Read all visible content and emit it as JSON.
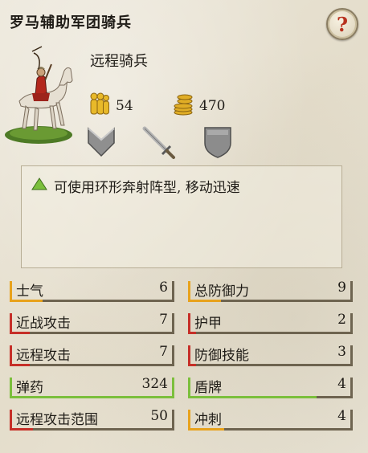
{
  "header": {
    "title": "罗马辅助军团骑兵",
    "help_label": "?"
  },
  "unit": {
    "type_label": "远程骑兵",
    "men": "54",
    "cost": "470",
    "icons": [
      "men-icon",
      "coins-icon",
      "armor-chevron-icon",
      "sword-icon",
      "shield-icon"
    ]
  },
  "abilities": [
    {
      "text": "可使用环形奔射阵型, 移动迅速",
      "icon": "green-triangle-icon"
    }
  ],
  "stats": {
    "left": [
      {
        "label": "士气",
        "value": "6",
        "level": 0.2,
        "color": "#e8a21c"
      },
      {
        "label": "近战攻击",
        "value": "7",
        "level": 0.12,
        "color": "#c62f28"
      },
      {
        "label": "远程攻击",
        "value": "7",
        "level": 0.12,
        "color": "#c62f28"
      },
      {
        "label": "弹药",
        "value": "324",
        "level": 1.0,
        "color": "#7bbf3c"
      },
      {
        "label": "远程攻击范围",
        "value": "50",
        "level": 0.14,
        "color": "#c62f28"
      }
    ],
    "right": [
      {
        "label": "总防御力",
        "value": "9",
        "level": 0.2,
        "color": "#e8a21c"
      },
      {
        "label": "护甲",
        "value": "2",
        "level": 0.05,
        "color": "#c62f28"
      },
      {
        "label": "防御技能",
        "value": "3",
        "level": 0.05,
        "color": "#c62f28"
      },
      {
        "label": "盾牌",
        "value": "4",
        "level": 0.78,
        "color": "#7bbf3c"
      },
      {
        "label": "冲刺",
        "value": "4",
        "level": 0.22,
        "color": "#e8a21c"
      }
    ]
  }
}
